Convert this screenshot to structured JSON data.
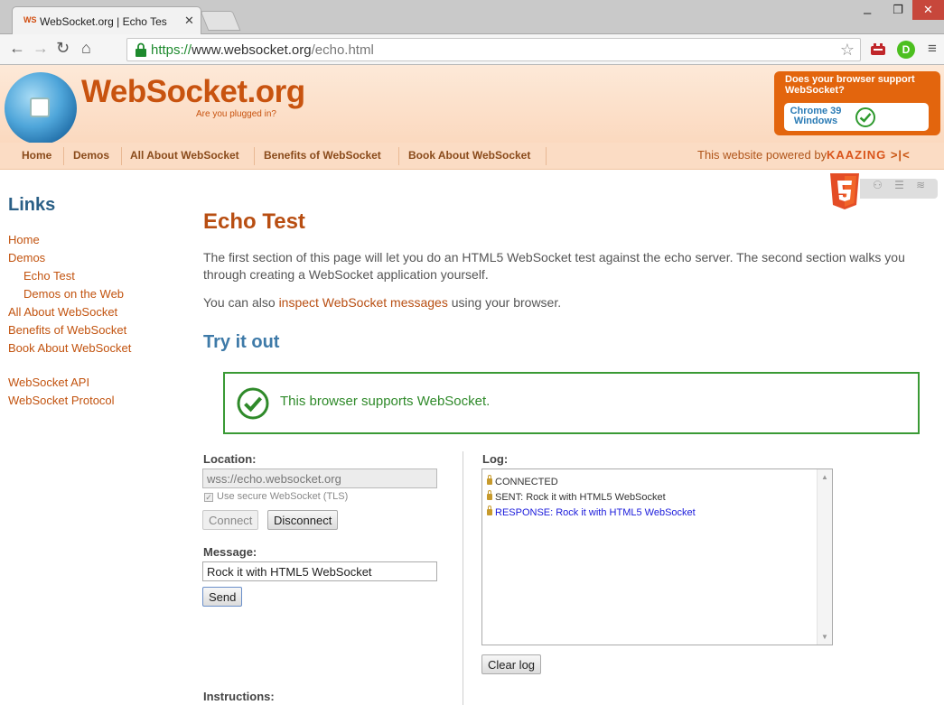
{
  "browser": {
    "tab_title": "WebSocket.org | Echo Tes",
    "tab_favicon": "WS",
    "url_scheme": "https://",
    "url_host": "www.websocket.org",
    "url_path": "/echo.html"
  },
  "header": {
    "logo": "WebSocket.org",
    "tagline": "Are you plugged in?",
    "support_title": "Does your browser support WebSocket?",
    "support_browser_line1": "Chrome 39",
    "support_browser_line2": "Windows"
  },
  "nav": {
    "items": [
      "Home",
      "Demos",
      "All About WebSocket",
      "Benefits of WebSocket",
      "Book About WebSocket"
    ],
    "powered_by": "This website powered by",
    "kaazing": "KAAZING"
  },
  "sidebar": {
    "title": "Links",
    "links": [
      "Home",
      "Demos",
      "Echo Test",
      "Demos on the Web",
      "All About WebSocket",
      "Benefits of WebSocket",
      "Book About WebSocket",
      "WebSocket API",
      "WebSocket Protocol"
    ]
  },
  "main": {
    "title": "Echo Test",
    "intro": "The first section of this page will let you do an HTML5 WebSocket test against the echo server. The second section walks you through creating a WebSocket application yourself.",
    "intro2_prefix": "You can also ",
    "intro2_link": "inspect WebSocket messages",
    "intro2_suffix": " using your browser.",
    "try_title": "Try it out",
    "banner_text": "This browser supports WebSocket.",
    "location_label": "Location:",
    "location_value": "wss://echo.websocket.org",
    "tls_label": "Use secure WebSocket (TLS)",
    "connect_label": "Connect",
    "disconnect_label": "Disconnect",
    "message_label": "Message:",
    "message_value": "Rock it with HTML5 WebSocket",
    "send_label": "Send",
    "log_label": "Log:",
    "log": [
      {
        "text": "CONNECTED",
        "color": "#333333"
      },
      {
        "text": "SENT: Rock it with HTML5 WebSocket",
        "color": "#333333"
      },
      {
        "text": "RESPONSE: Rock it with HTML5 WebSocket",
        "color": "#1a1adb"
      }
    ],
    "clear_log_label": "Clear log",
    "instructions_label": "Instructions:"
  },
  "colors": {
    "brand_orange": "#c8530f",
    "link_blue": "#2a5f86",
    "success_green": "#3a9a35"
  }
}
